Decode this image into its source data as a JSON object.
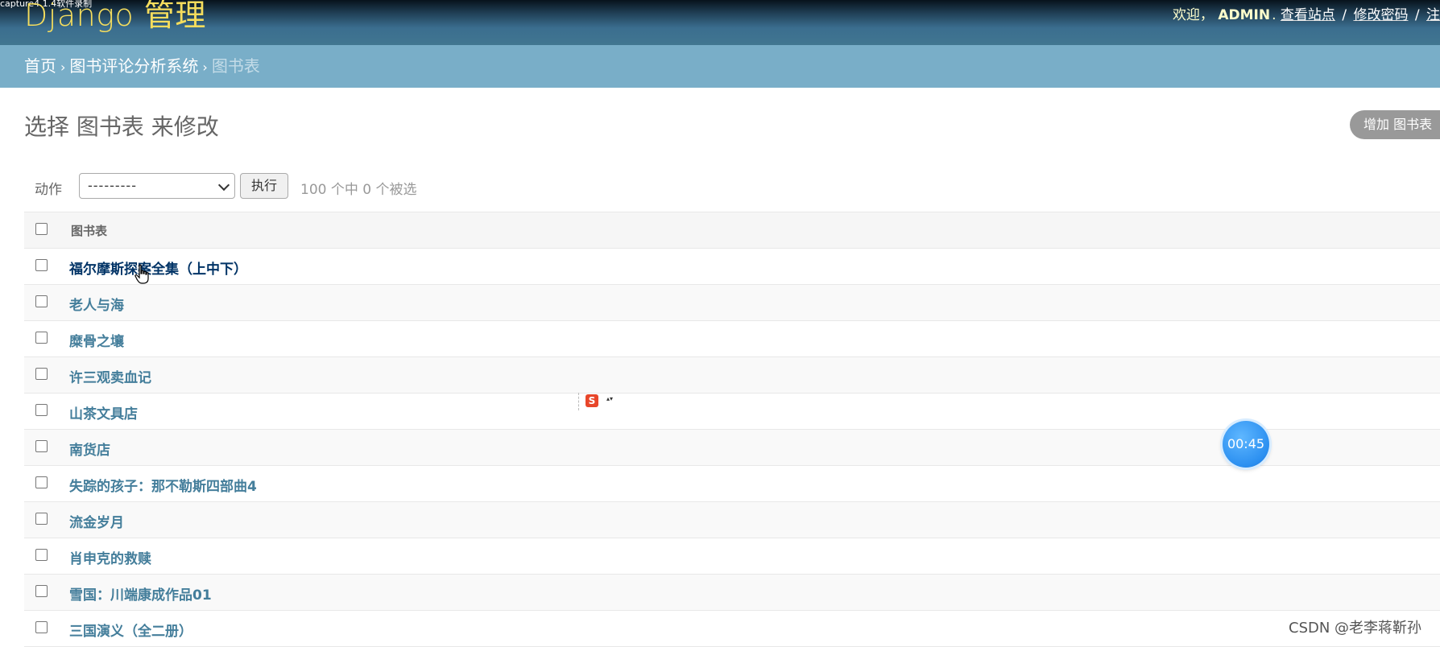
{
  "header": {
    "capture_text": "capture4.1.4软件录制",
    "branding": "Django 管理",
    "user_tools": {
      "welcome": "欢迎，",
      "username": "ADMIN",
      "dot": ".",
      "view_site": "查看站点",
      "sep": "/",
      "change_password": "修改密码",
      "sep2": "/",
      "logout_partial": "注"
    }
  },
  "breadcrumbs": {
    "home": "首页",
    "arrow": "›",
    "app": "图书评论分析系统",
    "current": "图书表"
  },
  "content": {
    "title": "选择 图书表 来修改",
    "add_button": "增加 图书表"
  },
  "actions": {
    "label": "动作",
    "select_value": "---------",
    "go_button": "执行",
    "selection_count": "100 个中 0 个被选"
  },
  "table": {
    "column_header": "图书表",
    "rows": [
      "福尔摩斯探案全集（上中下）",
      "老人与海",
      "糜骨之壤",
      "许三观卖血记",
      "山茶文具店",
      "南货店",
      "失踪的孩子：那不勒斯四部曲4",
      "流金岁月",
      "肖申克的救赎",
      "雪国：川端康成作品01",
      "三国演义（全二册）"
    ]
  },
  "overlay": {
    "ime_logo": "S",
    "ime_menu": "▴▾",
    "timer": "00:45",
    "watermark": "CSDN @老李蒋靳孙"
  },
  "colors": {
    "branding": "#f5dd5d",
    "breadcrumbs_bg": "#79aec8",
    "link": "#447e9b",
    "link_hover": "#003366",
    "add_button_bg": "#999999"
  }
}
